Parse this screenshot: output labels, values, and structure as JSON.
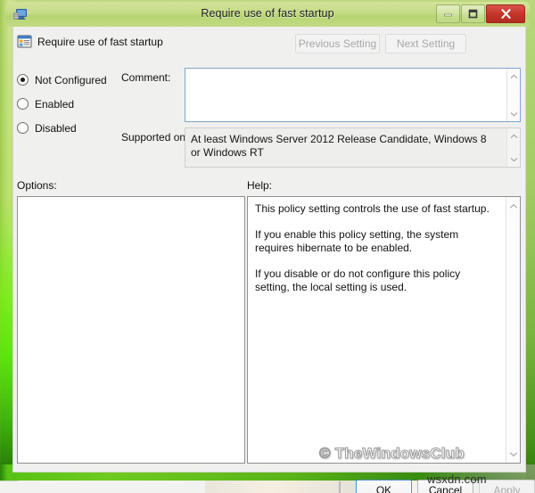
{
  "window": {
    "title": "Require use of fast startup",
    "icon": "computer-policy-icon",
    "buttons": {
      "minimize": "minimize-icon",
      "maximize": "maximize-icon",
      "close": "close-icon"
    }
  },
  "header": {
    "policy_icon": "policy-setting-icon",
    "policy_title": "Require use of fast startup",
    "previous_setting": "Previous Setting",
    "next_setting": "Next Setting"
  },
  "state_options": [
    {
      "label": "Not Configured",
      "selected": true
    },
    {
      "label": "Enabled",
      "selected": false
    },
    {
      "label": "Disabled",
      "selected": false
    }
  ],
  "comment": {
    "label": "Comment:",
    "value": "",
    "placeholder": ""
  },
  "supported_on": {
    "label": "Supported on:",
    "value": "At least Windows Server 2012 Release Candidate, Windows 8 or Windows RT"
  },
  "options": {
    "label": "Options:",
    "items": []
  },
  "help": {
    "label": "Help:",
    "paragraphs": [
      "This policy setting controls the use of fast startup.",
      "If you enable this policy setting, the system requires hibernate to be enabled.",
      "If you disable or do not configure this policy setting, the local setting is used."
    ]
  },
  "watermarks": {
    "help_panel": "© TheWindowsClub",
    "bottom_right": "wsxdn.com"
  },
  "actions": {
    "ok": "OK",
    "cancel": "Cancel",
    "apply": "Apply"
  },
  "colors": {
    "frame_green": "#9ec456",
    "titlebar_green": "#c6dc88",
    "close_red": "#c5362c",
    "focus_blue": "#4a90c8",
    "comment_border": "#7ea6c8"
  }
}
